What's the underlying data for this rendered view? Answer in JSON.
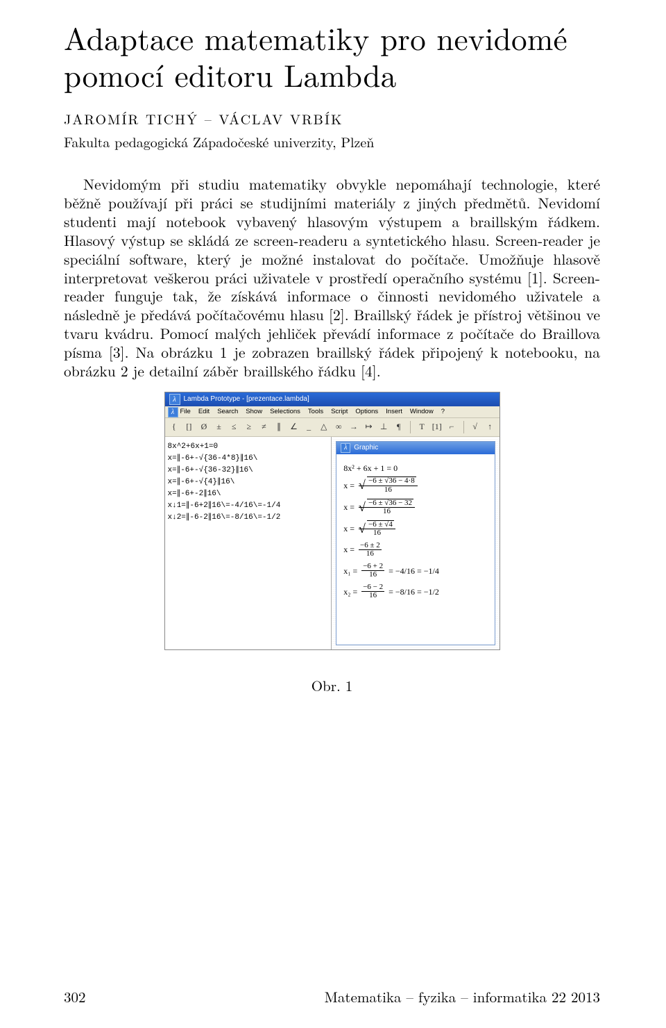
{
  "title": "Adaptace matematiky pro nevidomé pomocí editoru Lambda",
  "authors": "JAROMÍR TICHÝ – VÁCLAV VRBÍK",
  "affiliation": "Fakulta pedagogická Západočeské univerzity, Plzeň",
  "body": "Nevidomým při studiu matematiky obvykle nepomáhají technologie, které běžně používají při práci se studijními materiály z jiných předmětů. Nevidomí studenti mají notebook vybavený hlasovým výstupem a braillským řádkem. Hlasový výstup se skládá ze screen-readeru a syntetického hlasu. Screen-reader je speciální software, který je možné instalovat do počítače. Umožňuje hlasově interpretovat veškerou práci uživatele v prostředí operačního systému [1]. Screen-reader funguje tak, že získává informace o činnosti nevidomého uživatele a následně je předává počítačovému hlasu [2]. Braillský řádek je přístroj většinou ve tvaru kvádru. Pomocí malých jehliček převádí informace z počítače do Braillova písma [3]. Na obrázku 1 je zobrazen braillský řádek připojený k notebooku, na obrázku 2 je detailní záběr braillského řádku [4].",
  "figure": {
    "window_title": "Lambda Prototype - [prezentace.lambda]",
    "menu": [
      "File",
      "Edit",
      "Search",
      "Show",
      "Selections",
      "Tools",
      "Script",
      "Options",
      "Insert",
      "Window",
      "?"
    ],
    "toolbar": [
      "{",
      "[]",
      "Ø",
      "±",
      "≤",
      "≥",
      "≠",
      "∥",
      "∠",
      "_",
      "△",
      "∞",
      "→",
      "↦",
      "⊥",
      "¶",
      "T",
      "[1]",
      "⌐",
      "√",
      "↑"
    ],
    "editor_lines": [
      "8x^2+6x+1=0",
      "x=∥-6+-√{36-4*8}∥16\\",
      "x=∥-6+-√{36-32}∥16\\",
      "x=∥-6+-√{4}∥16\\",
      "x=∥-6+-2∥16\\",
      "x↓1=∥-6+2∥16\\=-4/16\\=-1/4",
      "x↓2=∥-6-2∥16\\=-8/16\\=-1/2"
    ],
    "graphic_title": "Graphic",
    "eq_top": "8x² + 6x + 1 = 0",
    "frac1_num": "−6 ± √36 − 4·8",
    "frac1_den": "16",
    "frac2_num": "−6 ± √36 − 32",
    "frac2_den": "16",
    "frac3_num": "−6 ± √4",
    "frac3_den": "16",
    "frac4_num": "−6 ± 2",
    "frac4_den": "16",
    "x1_lhs": "x₁ =",
    "x1_frac_num": "−6 + 2",
    "x1_frac_den": "16",
    "x1_rhs": "= −4/16 = −1/4",
    "x2_lhs": "x₂ =",
    "x2_frac_num": "−6 − 2",
    "x2_frac_den": "16",
    "x2_rhs": "= −8/16 = −1/2"
  },
  "caption": "Obr. 1",
  "footer_left": "302",
  "footer_right": "Matematika – fyzika – informatika 22 2013"
}
